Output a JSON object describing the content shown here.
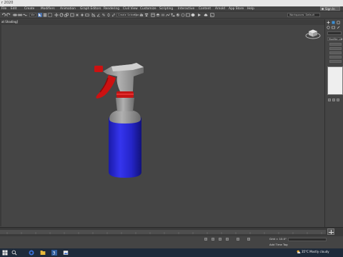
{
  "app": {
    "title": "r 2020"
  },
  "menu": {
    "items": [
      "File",
      "Edit",
      "Create",
      "Modifiers",
      "Animation",
      "Graph Editors",
      "Rendering",
      "Civil View",
      "Customize",
      "Scripting",
      "Interactive",
      "Content",
      "Arnold",
      "App Store",
      "Help"
    ],
    "sign_in": "Sign In"
  },
  "toolbar": {
    "selection_filter": "Vie",
    "named_selection": "Create Selection Se",
    "workspace": "Workspaces: Default"
  },
  "viewport": {
    "label": "at Shading]"
  },
  "command_panel": {
    "modifier_list": "Modifier List"
  },
  "status": {
    "grid": "Grid = 10.0\"",
    "add_time_tag": "Add Time Tag"
  },
  "taskbar": {
    "temperature": "35°C",
    "weather": "Mostly cloudy"
  },
  "colors": {
    "bottle_body": "#2a2adb",
    "trigger": "#cc1111",
    "sprayer_gray": "#9a9a9a",
    "viewport_bg": "#454545",
    "accent": "#2b6fd6"
  },
  "icons": [
    "undo-icon",
    "redo-icon",
    "link-icon",
    "unlink-icon",
    "bind-space-warp-icon",
    "select-icon",
    "select-by-name-icon",
    "region-select-icon",
    "move-icon",
    "rotate-icon",
    "scale-icon",
    "snap-icon",
    "angle-snap-icon",
    "percent-snap-icon",
    "mirror-icon",
    "align-icon",
    "render-icon",
    "viewcube-icon",
    "plus-icon",
    "windows-start-icon"
  ]
}
